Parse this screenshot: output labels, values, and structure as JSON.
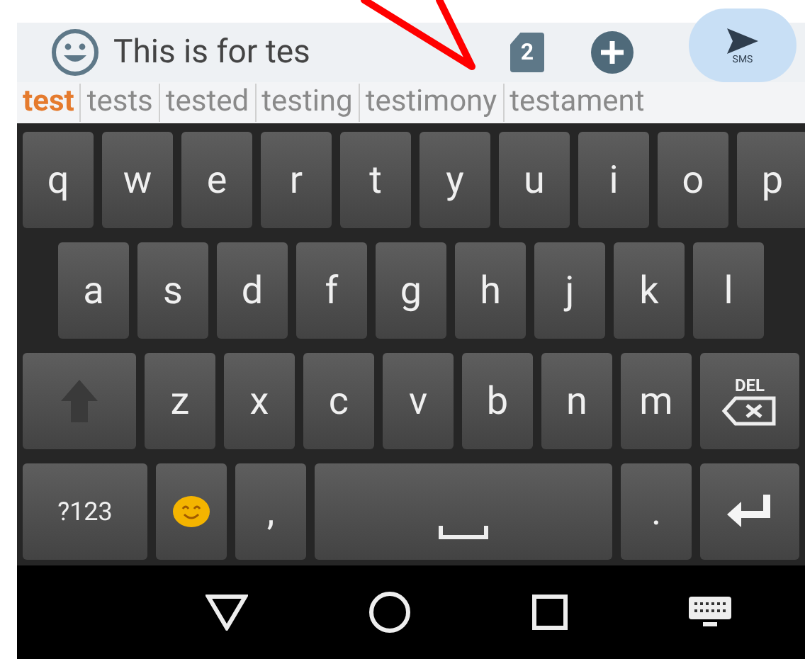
{
  "compose": {
    "message": "This is for tes",
    "sim_badge": "2",
    "send_label": "SMS"
  },
  "suggestions": [
    {
      "label": "test",
      "selected": true
    },
    {
      "label": "tests",
      "selected": false
    },
    {
      "label": "tested",
      "selected": false
    },
    {
      "label": "testing",
      "selected": false
    },
    {
      "label": "testimony",
      "selected": false
    },
    {
      "label": "testament",
      "selected": false
    }
  ],
  "keyboard": {
    "top_row": [
      {
        "kind": "letter",
        "label": "q"
      },
      {
        "kind": "letter",
        "label": "w"
      },
      {
        "kind": "letter",
        "label": "e"
      },
      {
        "kind": "letter",
        "label": "r"
      },
      {
        "kind": "letter",
        "label": "t"
      },
      {
        "kind": "letter",
        "label": "y"
      },
      {
        "kind": "letter",
        "label": "u"
      },
      {
        "kind": "letter",
        "label": "i"
      },
      {
        "kind": "letter",
        "label": "o"
      },
      {
        "kind": "letter",
        "label": "p"
      }
    ],
    "home_row": [
      {
        "kind": "letter",
        "label": "a"
      },
      {
        "kind": "letter",
        "label": "s"
      },
      {
        "kind": "letter",
        "label": "d"
      },
      {
        "kind": "letter",
        "label": "f"
      },
      {
        "kind": "letter",
        "label": "g"
      },
      {
        "kind": "letter",
        "label": "h"
      },
      {
        "kind": "letter",
        "label": "j"
      },
      {
        "kind": "letter",
        "label": "k"
      },
      {
        "kind": "letter",
        "label": "l"
      }
    ],
    "bottom_row": [
      {
        "kind": "shift"
      },
      {
        "kind": "letter",
        "label": "z"
      },
      {
        "kind": "letter",
        "label": "x"
      },
      {
        "kind": "letter",
        "label": "c"
      },
      {
        "kind": "letter",
        "label": "v"
      },
      {
        "kind": "letter",
        "label": "b"
      },
      {
        "kind": "letter",
        "label": "n"
      },
      {
        "kind": "letter",
        "label": "m"
      },
      {
        "kind": "delete",
        "label": "DEL"
      }
    ],
    "function_row": [
      {
        "kind": "symbols",
        "label": "?123"
      },
      {
        "kind": "emoji"
      },
      {
        "kind": "letter",
        "label": ","
      },
      {
        "kind": "space"
      },
      {
        "kind": "letter",
        "label": "."
      },
      {
        "kind": "enter"
      }
    ]
  }
}
